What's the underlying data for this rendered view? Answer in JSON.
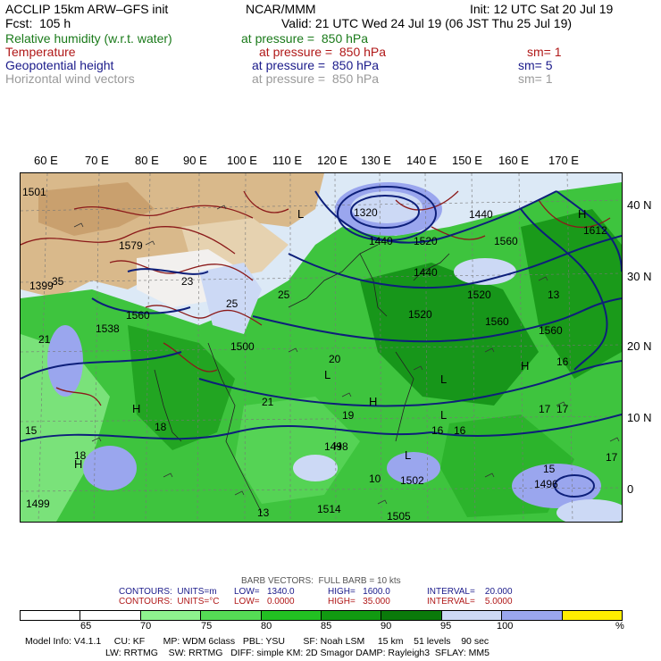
{
  "header": {
    "line1_left": "ACCLIP 15km ARW–GFS init",
    "line1_mid": "NCAR/MMM",
    "line1_right": "Init: 12 UTC Sat 20 Jul 19",
    "line2_left": "Fcst:  105 h",
    "line2_right": "Valid: 21 UTC Wed 24 Jul 19 (06 JST Thu 25 Jul 19)",
    "fields": [
      {
        "name": "Relative humidity (w.r.t. water)",
        "pressure": "at pressure =  850 hPa",
        "sm": "",
        "color": "#1a7a1a"
      },
      {
        "name": "Temperature",
        "pressure": "at pressure =  850 hPa",
        "sm": "sm= 1",
        "color": "#b01818"
      },
      {
        "name": "Geopotential height",
        "pressure": "at pressure =  850 hPa",
        "sm": "sm= 5",
        "color": "#1a1a8a"
      },
      {
        "name": "Horizontal wind vectors",
        "pressure": "at pressure =  850 hPa",
        "sm": "sm= 1",
        "color": "#9a9a9a"
      }
    ]
  },
  "axes": {
    "lon": [
      "60 E",
      "70 E",
      "80 E",
      "90 E",
      "100 E",
      "110 E",
      "120 E",
      "130 E",
      "140 E",
      "150 E",
      "160 E",
      "170 E"
    ],
    "lat": [
      "40 N",
      "30 N",
      "20 N",
      "10 N",
      "0"
    ]
  },
  "map_labels": {
    "heights": [
      "1501",
      "1579",
      "1399",
      "1560",
      "1538",
      "1500",
      "1320",
      "1440",
      "1440",
      "1520",
      "1520",
      "1440",
      "1560",
      "1520",
      "1560",
      "1560",
      "1612",
      "1499",
      "1514",
      "1505",
      "1502",
      "1496",
      "1498"
    ],
    "temps": [
      "35",
      "23",
      "25",
      "25",
      "20",
      "18",
      "17",
      "16",
      "19",
      "21",
      "15",
      "18",
      "17",
      "13",
      "15",
      "16",
      "13",
      "16",
      "21",
      "17",
      "10"
    ],
    "lows": [
      "L",
      "L",
      "L",
      "L",
      "L"
    ],
    "highs": [
      "H",
      "H",
      "H",
      "H",
      "H",
      "H"
    ]
  },
  "footer": {
    "barb": "BARB VECTORS:  FULL BARB = 10 kts",
    "contours1": {
      "label": "CONTOURS:  UNITS=m",
      "low": "LOW=   1340.0",
      "high": "HIGH=   1600.0",
      "interval": "INTERVAL=    20.000"
    },
    "contours2": {
      "label": "CONTOURS:  UNITS=°C",
      "low": "LOW=   0.0000",
      "high": "HIGH=   35.000",
      "interval": "INTERVAL=    5.0000"
    },
    "colorbar_ticks": [
      "65",
      "70",
      "75",
      "80",
      "85",
      "90",
      "95",
      "100",
      "%"
    ],
    "colorbar_colors": [
      "#ffffff",
      "#ffffff",
      "#8ef28e",
      "#55dc55",
      "#22c022",
      "#119a11",
      "#0a7a0a",
      "#ccd9f5",
      "#9aa6ee",
      "#ffee00"
    ],
    "model1": "Model Info: V4.1.1     CU: KF       MP: WDM 6class   PBL: YSU       SF: Noah LSM     15 km    51 levels    90 sec",
    "model2": "LW: RRTMG    SW: RRTMG   DIFF: simple KM: 2D Smagor DAMP: Rayleigh3  SFLAY: MM5"
  }
}
